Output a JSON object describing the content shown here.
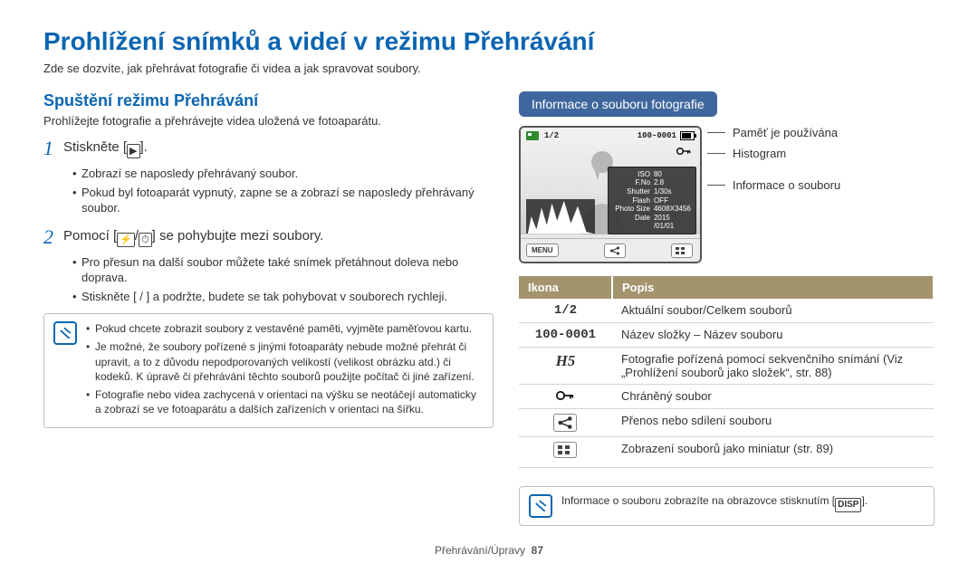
{
  "page": {
    "title": "Prohlížení snímků a videí v režimu Přehrávání",
    "intro": "Zde se dozvíte, jak přehrávat fotografie či videa a jak spravovat soubory.",
    "footer_left": "Přehrávání/Úpravy",
    "footer_page": "87"
  },
  "left": {
    "section_title": "Spuštění režimu Přehrávání",
    "section_desc": "Prohlížejte fotografie a přehrávejte videa uložená ve fotoaparátu.",
    "step1": {
      "num": "1",
      "text": "Stiskněte ["
    },
    "step1_after": "].",
    "step1_bullets": [
      "Zobrazí se naposledy přehrávaný soubor.",
      "Pokud byl fotoaparát vypnutý, zapne se a zobrazí se naposledy přehrávaný soubor."
    ],
    "step2": {
      "num": "2",
      "text_pre": "Pomocí [",
      "text_mid": "/",
      "text_post": "] se pohybujte mezi soubory."
    },
    "step2_bullets": [
      "Pro přesun na další soubor můžete také snímek přetáhnout doleva nebo doprava.",
      "Stiskněte [ /  ] a podržte, budete se tak pohybovat v souborech rychleji."
    ],
    "notes": [
      "Pokud chcete zobrazit soubory z vestavěné paměti, vyjměte paměťovou kartu.",
      "Je možné, že soubory pořízené s jinými fotoaparáty nebude možné přehrát či upravit, a to z důvodu nepodporovaných velikostí (velikost obrázku atd.) či kodeků. K úpravě či přehrávání těchto souborů použijte počítač či jiné zařízení.",
      "Fotografie nebo videa zachycená v orientaci na výšku se neotáčejí automaticky a zobrazí se ve fotoaparátu a dalších zařízeních v orientaci na šířku."
    ]
  },
  "right": {
    "header": "Informace o souboru fotografie",
    "screen": {
      "counter": "1/2",
      "filenum": "100-0001",
      "menu_label": "MENU",
      "info": {
        "iso_k": "ISO",
        "iso_v": "80",
        "fno_k": "F.No",
        "fno_v": "2.8",
        "sh_k": "Shutter",
        "sh_v": "1/30s",
        "fl_k": "Flash",
        "fl_v": "OFF",
        "ps_k": "Photo Size",
        "ps_v": "4608X3456",
        "dt_k": "Date",
        "dt_v": "2015 /01/01"
      }
    },
    "callouts": {
      "c1": "Paměť je používána",
      "c2": "Histogram",
      "c3": "Informace o souboru"
    },
    "table": {
      "th1": "Ikona",
      "th2": "Popis",
      "rows": [
        {
          "icon": "1/2",
          "kind": "text",
          "desc": "Aktuální soubor/Celkem souborů"
        },
        {
          "icon": "100-0001",
          "kind": "text",
          "desc": "Název složky – Název souboru"
        },
        {
          "icon": "H5",
          "kind": "boldit",
          "desc": "Fotografie pořízená pomocí sekvenčního snímání (Viz „Prohlížení souborů jako složek“, str. 88)"
        },
        {
          "icon": "key",
          "kind": "svg",
          "desc": "Chráněný soubor"
        },
        {
          "icon": "share",
          "kind": "svg",
          "desc": "Přenos nebo sdílení souboru"
        },
        {
          "icon": "grid",
          "kind": "svg",
          "desc": "Zobrazení souborů jako miniatur (str. 89)"
        }
      ]
    },
    "bottom_note": "Informace o souboru zobrazíte na obrazovce stisknutím [",
    "bottom_note_after": "]."
  }
}
